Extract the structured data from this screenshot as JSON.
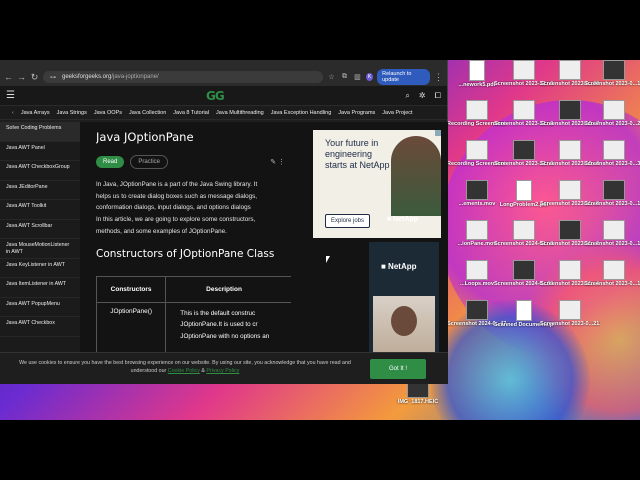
{
  "browser": {
    "url_host": "geeksforgeeks.org",
    "url_path": "/java-joptionpane/",
    "relaunch_label": "Relaunch to update",
    "avatar_letter": "K"
  },
  "site": {
    "logo": "GG",
    "topics": [
      "Java Arrays",
      "Java Strings",
      "Java OOPs",
      "Java Collection",
      "Java 8 Tutorial",
      "Java Multithreading",
      "Java Exception Handling",
      "Java Programs",
      "Java Project"
    ]
  },
  "sidebar": {
    "items": [
      "Solve Coding Problems",
      "Java AWT Panel",
      "Java AWT CheckboxGroup",
      "Java JEditorPane",
      "Java AWT Toolkit",
      "Java AWT Scrollbar",
      "Java MouseMotionListener in AWT",
      "Java KeyListener in AWT",
      "Java ItemListener in AWT",
      "Java AWT PopupMenu",
      "Java AWT Checkbox"
    ]
  },
  "article": {
    "title": "Java JOptionPane",
    "read_label": "Read",
    "practice_label": "Practice",
    "body_lines": [
      "In Java, JOptionPane is a part of the Java Swing library. It",
      "helps us to create dialog boxes such as message dialogs,",
      "conformation dialogs, input dialogs, and options dialogs",
      "In this article, we are going to explore some constructors,",
      "methods, and some examples of JOptionPane."
    ],
    "heading": "Constructors of JOptionPane Class",
    "table": {
      "headers": [
        "Constructors",
        "Description"
      ],
      "row1_constructor": "JOptionPane()",
      "row1_desc": [
        "This is the default construc",
        "JOptionPane.It is used to cr",
        "JOptionPane with no options an"
      ]
    }
  },
  "ads": {
    "ad1_text": "Your future in engineering starts at NetApp",
    "ad1_button": "Explore jobs",
    "ad1_brand": "■ NetApp",
    "ad2_brand": "■ NetApp"
  },
  "cookie": {
    "text": "We use cookies to ensure you have the best browsing experience on our website. By using our site, you acknowledge that you have read and understood our",
    "cookie_policy": "Cookie Policy",
    "amp": "&",
    "privacy_policy": "Privacy Policy",
    "button": "Got It !"
  },
  "desktop": {
    "icons": [
      {
        "label": "...nework5.pdf"
      },
      {
        "label": "Screenshot 2023-12...0.36 PM"
      },
      {
        "label": "Screenshot 2023-0...09.06 PM"
      },
      {
        "label": "Screenshot 2023-0...17.11 PM"
      },
      {
        "label": "Recording Screenshot ...0.AM.mov"
      },
      {
        "label": "Screenshot 2023-12...2.00 PM"
      },
      {
        "label": "Screenshot 2023-10...7.49 PM"
      },
      {
        "label": "Screenshot 2023-0...24.53 PM"
      },
      {
        "label": "Recording Screenshot ...0.AM.mov"
      },
      {
        "label": "Screenshot 2023-12...0.27 PM"
      },
      {
        "label": "Screenshot 2023-10...8.32 PM"
      },
      {
        "label": "Screenshot 2023-0...38.43 PM"
      },
      {
        "label": "...ements.mov"
      },
      {
        "label": "LongProblem2.pdf"
      },
      {
        "label": "Screenshot 2023-11...8.52 PM"
      },
      {
        "label": "Screenshot 2023-0...10.49 PM"
      },
      {
        "label": "...ionPane.mov"
      },
      {
        "label": "Screenshot 2024-01...8.35 AM"
      },
      {
        "label": "Screenshot 2023-11...2.05 PM"
      },
      {
        "label": "Screenshot 2023-0...11.04 PM"
      },
      {
        "label": "...Loops.mov"
      },
      {
        "label": "Screenshot 2024-0...09.04 PM"
      },
      {
        "label": "Screenshot 2023-11...4.32 PM"
      },
      {
        "label": "Screenshot 2023-0...13.14 PM"
      },
      {
        "label": "Screenshot 2024-0...47.26 PM"
      },
      {
        "label": "Scanned Documents.pdf"
      },
      {
        "label": "Screenshot 2023-0...21.42 PM"
      },
      {
        "label": "IMG_1817.HEIC"
      }
    ]
  }
}
